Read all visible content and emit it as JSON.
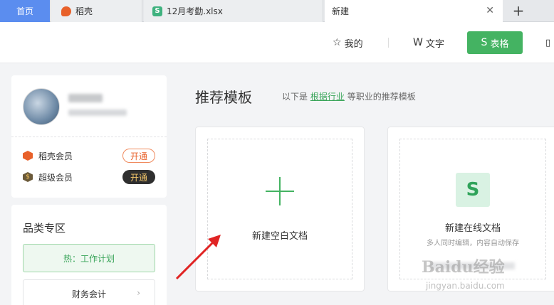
{
  "tabs": {
    "home": "首页",
    "tab1": "稻壳",
    "tab2": "12月考勤.xlsx",
    "tab3": "新建",
    "close_glyph": "✕",
    "new_tab_glyph": "+"
  },
  "header": {
    "mine": "我的",
    "text": "文字",
    "sheet": "表格",
    "mine_icon": "star-icon",
    "text_icon": "w-icon",
    "sheet_icon": "s-icon",
    "accent": "#44b362"
  },
  "user": {
    "membership": [
      {
        "label": "稻壳会员",
        "button": "开通",
        "icon": "daoke-icon"
      },
      {
        "label": "超级会员",
        "button": "开通",
        "icon": "super-icon"
      }
    ]
  },
  "category": {
    "title": "品类专区",
    "hot": "热：工作计划",
    "finance": "财务会计",
    "chevron": "›"
  },
  "main": {
    "title": "推荐模板",
    "subtitle_prefix": "以下是",
    "subtitle_link": "根据行业",
    "subtitle_suffix": "等职业的推荐模板"
  },
  "cards": {
    "blank_label": "新建空白文档",
    "online_label": "新建在线文档",
    "online_desc": "多人同时编辑，内容自动保存",
    "s_glyph": "S"
  },
  "watermark": {
    "main": "Baidu经验",
    "sub": "jingyan.baidu.com"
  }
}
